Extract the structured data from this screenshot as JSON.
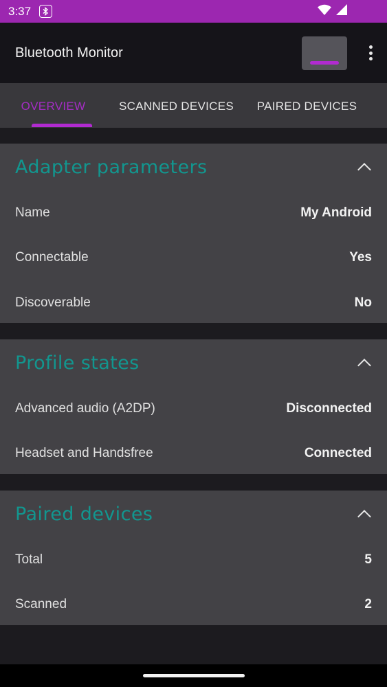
{
  "status_bar": {
    "time": "3:37",
    "icons": [
      "bluetooth-badge-icon",
      "wifi-icon",
      "signal-icon"
    ]
  },
  "app_bar": {
    "title": "Bluetooth Monitor"
  },
  "tabs": [
    {
      "label": "OVERVIEW",
      "selected": true
    },
    {
      "label": "SCANNED DEVICES",
      "selected": false
    },
    {
      "label": "PAIRED DEVICES",
      "selected": false
    }
  ],
  "adapter": {
    "title": "Adapter parameters",
    "rows": [
      {
        "label": "Name",
        "value": "My Android"
      },
      {
        "label": "Connectable",
        "value": "Yes"
      },
      {
        "label": "Discoverable",
        "value": "No"
      }
    ]
  },
  "profiles": {
    "title": "Profile states",
    "rows": [
      {
        "label": "Advanced audio (A2DP)",
        "value": "Disconnected"
      },
      {
        "label": "Headset and Handsfree",
        "value": "Connected"
      }
    ]
  },
  "paired": {
    "title": "Paired devices",
    "rows": [
      {
        "label": "Total",
        "value": "5"
      },
      {
        "label": "Scanned",
        "value": "2"
      }
    ]
  },
  "colors": {
    "accent": "#b12bd0",
    "status_bar": "#9c27b0",
    "card_title": "#12968f",
    "card_bg": "#434246",
    "tab_bar_bg": "#39383c"
  }
}
